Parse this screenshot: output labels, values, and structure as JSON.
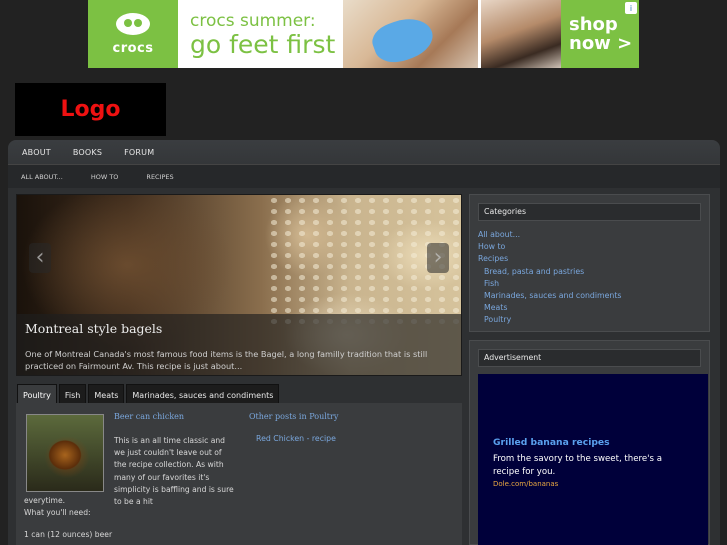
{
  "top_ad": {
    "brand": "crocs",
    "tagline_line1": "crocs summer:",
    "tagline_line2": "go feet first",
    "cta_line1": "shop",
    "cta_line2": "now >",
    "choices_icon": "i",
    "colors": {
      "brand_green": "#7cc143"
    }
  },
  "logo": {
    "text": "Logo",
    "color": "#ee1111"
  },
  "nav": {
    "main": [
      "ABOUT",
      "BOOKS",
      "FORUM"
    ],
    "sub": [
      "ALL ABOUT...",
      "HOW TO",
      "RECIPES"
    ]
  },
  "slider": {
    "title": "Montreal style bagels",
    "text": "One of Montreal Canada's most famous food items is the Bagel, a long familly tradition that is still practiced on Fairmount Av. This recipe is just about...",
    "prev_icon": "‹",
    "next_icon": "›"
  },
  "tabs": [
    "Poultry",
    "Fish",
    "Meats",
    "Marinades, sauces and condiments"
  ],
  "post": {
    "title": "Beer can chicken",
    "body_side": "This is an all time classic and we just couldn't leave out of the recipe collection. As with many of our favorites it's simplicity is baffling and is sure to be a hit",
    "body_cont_line1": "everytime.",
    "body_cont_line2": "What you'll need:",
    "ingredient": "1 can (12 ounces) beer"
  },
  "other_posts": {
    "title": "Other posts in Poultry",
    "link": "Red Chicken - recipe"
  },
  "sidebar": {
    "categories_title": "Categories",
    "categories": [
      {
        "label": "All about...",
        "sub": false
      },
      {
        "label": "How to",
        "sub": false
      },
      {
        "label": "Recipes",
        "sub": false
      },
      {
        "label": "Bread, pasta and pastries",
        "sub": true
      },
      {
        "label": "Fish",
        "sub": true
      },
      {
        "label": "Marinades, sauces and condiments",
        "sub": true
      },
      {
        "label": "Meats",
        "sub": true
      },
      {
        "label": "Poultry",
        "sub": true
      }
    ],
    "ad_title": "Advertisement",
    "ad": {
      "title": "Grilled banana recipes",
      "text": "From the savory to the sweet, there's a recipe for you.",
      "url": "Dole.com/bananas"
    }
  }
}
